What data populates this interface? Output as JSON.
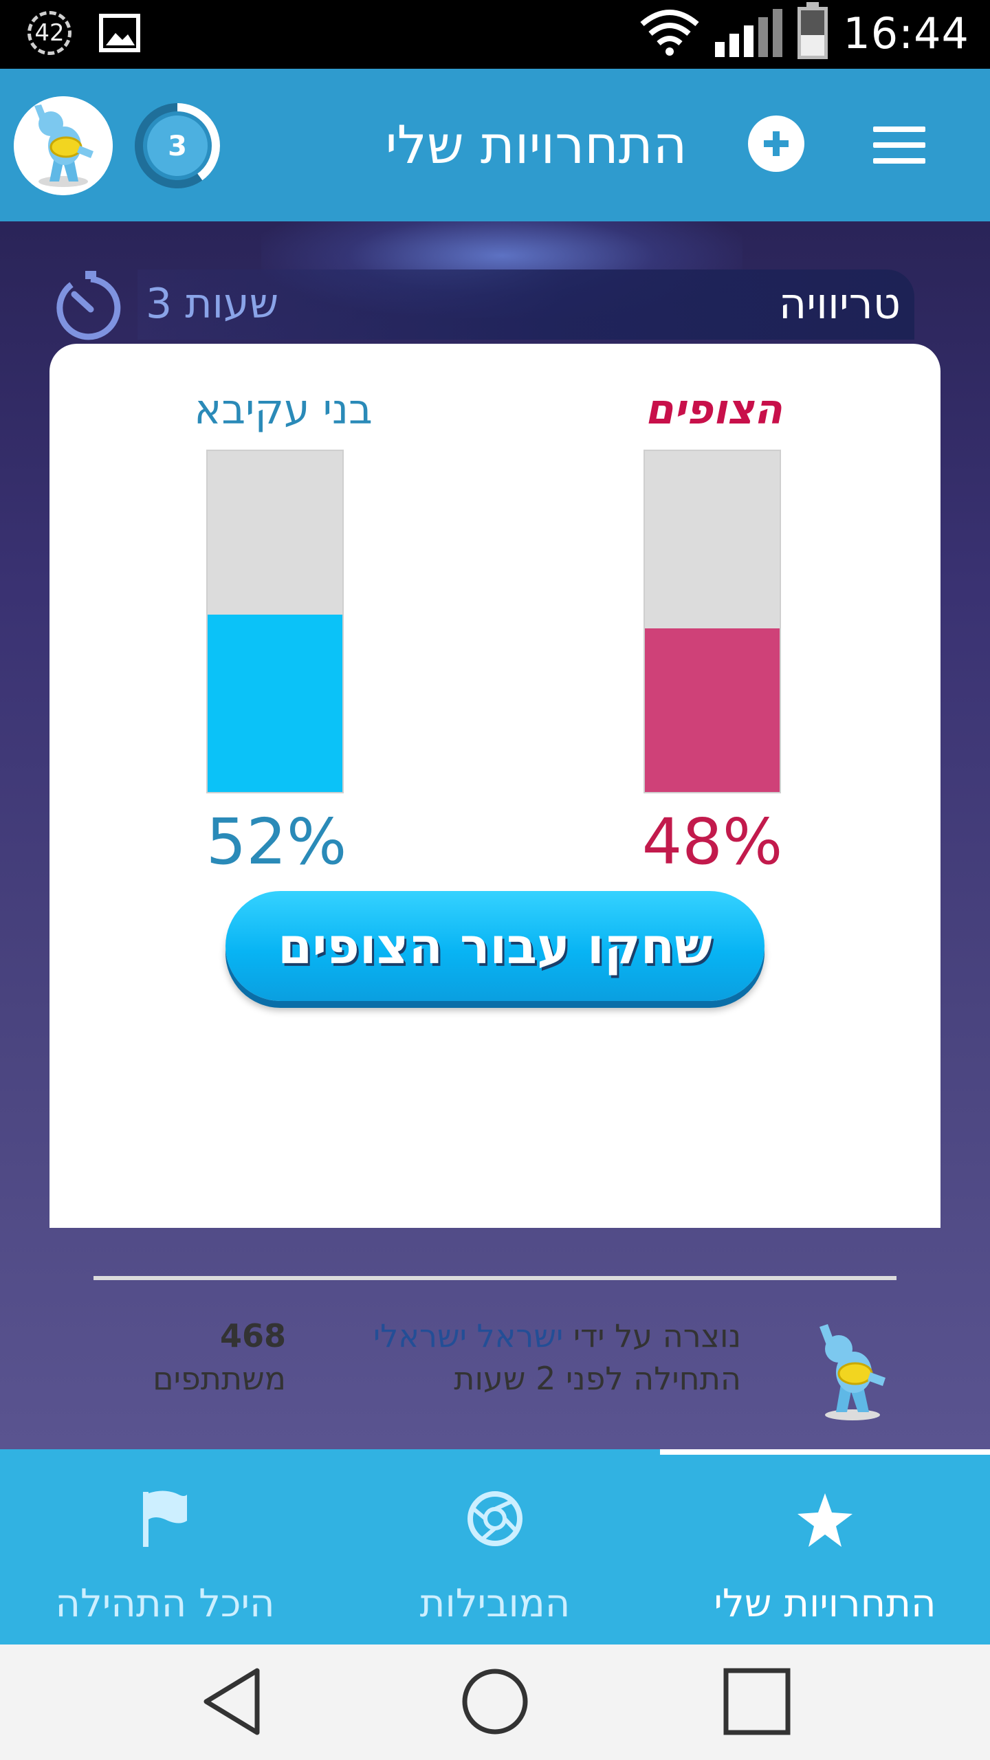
{
  "status_bar": {
    "notification_badge": "42",
    "time": "16:44",
    "icons": [
      "notification-count-icon",
      "image-icon",
      "wifi-icon",
      "signal-icon",
      "battery-icon"
    ],
    "battery_level": 0.45
  },
  "header": {
    "title": "התחרויות שלי",
    "level": "3",
    "level_progress": 0.4,
    "icons": [
      "user-avatar",
      "add-icon",
      "menu-icon"
    ]
  },
  "challenge": {
    "category": "טריוויה",
    "time_left": "3 שעות",
    "teams": [
      {
        "name": "בני עקיבא",
        "percent_label": "52%",
        "percent": 52,
        "color": "#0bc2f8"
      },
      {
        "name": "הצופים",
        "percent_label": "48%",
        "percent": 48,
        "color": "#cf4178"
      }
    ],
    "play_button": "שחקו עבור הצופים",
    "creator_prefix": "נוצרה על ידי",
    "creator_name": "ישראל ישראלי",
    "started": "התחילה לפני 2 שעות",
    "participants_count": "468",
    "participants_label": "משתתפים"
  },
  "tabs": [
    {
      "label": "התחרויות שלי",
      "icon": "star-icon",
      "active": true
    },
    {
      "label": "המובילות",
      "icon": "aperture-icon",
      "active": false
    },
    {
      "label": "היכל התהילה",
      "icon": "flag-icon",
      "active": false
    }
  ],
  "navbar": {
    "icons": [
      "back-icon",
      "home-icon",
      "recents-icon"
    ]
  },
  "colors": {
    "header": "#2f9bce",
    "tab_bar": "#31b2e2",
    "team_a": "#2a8ab8",
    "team_b": "#c8104a"
  }
}
